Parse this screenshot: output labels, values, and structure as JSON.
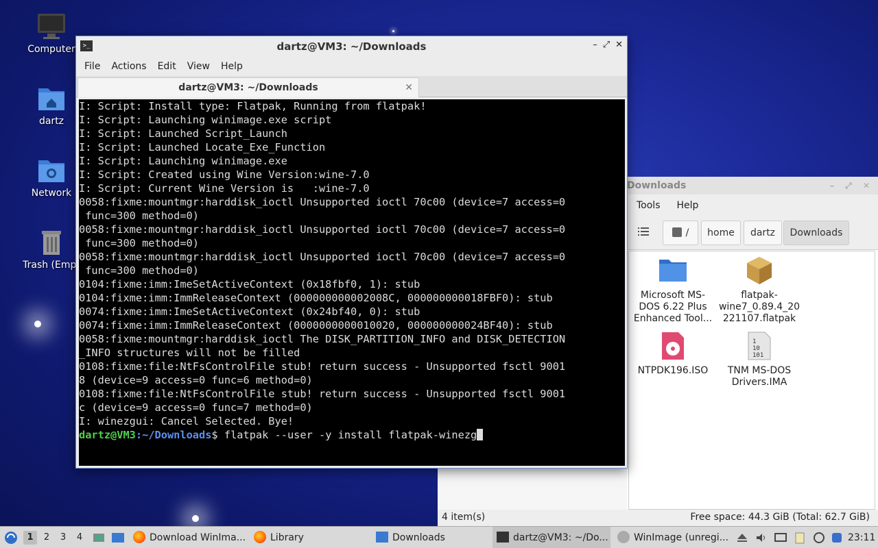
{
  "desktop": {
    "icons": [
      {
        "label": "Computer",
        "icon": "computer-icon"
      },
      {
        "label": "dartz",
        "icon": "home-folder-icon"
      },
      {
        "label": "Network",
        "icon": "network-folder-icon"
      },
      {
        "label": "Trash (Empt",
        "icon": "trash-icon"
      }
    ]
  },
  "terminal": {
    "window_title": "dartz@VM3: ~/Downloads",
    "menu": [
      "File",
      "Actions",
      "Edit",
      "View",
      "Help"
    ],
    "tab_title": "dartz@VM3: ~/Downloads",
    "lines": [
      "I: Script: Install type: Flatpak, Running from flatpak!",
      "I: Script: Launching winimage.exe script",
      "I: Script: Launched Script_Launch",
      "I: Script: Launched Locate_Exe_Function",
      "I: Script: Launching winimage.exe",
      "I: Script: Created using Wine Version:wine-7.0",
      "I: Script: Current Wine Version is   :wine-7.0",
      "0058:fixme:mountmgr:harddisk_ioctl Unsupported ioctl 70c00 (device=7 access=0",
      " func=300 method=0)",
      "0058:fixme:mountmgr:harddisk_ioctl Unsupported ioctl 70c00 (device=7 access=0",
      " func=300 method=0)",
      "0058:fixme:mountmgr:harddisk_ioctl Unsupported ioctl 70c00 (device=7 access=0",
      " func=300 method=0)",
      "0104:fixme:imm:ImeSetActiveContext (0x18fbf0, 1): stub",
      "0104:fixme:imm:ImmReleaseContext (000000000002008C, 000000000018FBF0): stub",
      "0074:fixme:imm:ImeSetActiveContext (0x24bf40, 0): stub",
      "0074:fixme:imm:ImmReleaseContext (0000000000010020, 000000000024BF40): stub",
      "0058:fixme:mountmgr:harddisk_ioctl The DISK_PARTITION_INFO and DISK_DETECTION",
      "_INFO structures will not be filled",
      "0108:fixme:file:NtFsControlFile stub! return success - Unsupported fsctl 9001",
      "8 (device=9 access=0 func=6 method=0)",
      "0108:fixme:file:NtFsControlFile stub! return success - Unsupported fsctl 9001",
      "c (device=9 access=0 func=7 method=0)",
      "I: winezgui: Cancel Selected. Bye!"
    ],
    "prompt_user": "dartz@VM3",
    "prompt_sep": ":",
    "prompt_path": "~/Downloads",
    "prompt_symbol": "$",
    "command": "flatpak --user -y install flatpak-winezg"
  },
  "filemanager": {
    "window_title": "Downloads",
    "menu": [
      "Tools",
      "Help"
    ],
    "crumbs": [
      "/",
      "home",
      "dartz",
      "Downloads"
    ],
    "files": [
      {
        "name": "Microsoft MS-DOS 6.22 Plus Enhanced Tool...",
        "icon": "folder-icon"
      },
      {
        "name": "flatpak-wine7_0.89.4_20221107.flatpak",
        "icon": "package-icon"
      },
      {
        "name": "NTPDK196.ISO",
        "icon": "disc-image-icon"
      },
      {
        "name": "TNM MS-DOS Drivers.IMA",
        "icon": "binary-file-icon"
      }
    ],
    "file_lines": [
      [
        "Microsoft MS-",
        "DOS 6.22 Plus",
        "Enhanced Tool..."
      ],
      [
        "flatpak-",
        "wine7_0.89.4_20",
        "221107.flatpak"
      ],
      [
        "NTPDK196.ISO"
      ],
      [
        "TNM MS-DOS",
        "Drivers.IMA"
      ]
    ],
    "status_items": "4 item(s)",
    "status_free": "Free space: 44.3 GiB (Total: 62.7 GiB)"
  },
  "taskbar": {
    "workspaces": [
      "1",
      "2",
      "3",
      "4"
    ],
    "tasks": [
      {
        "label": "Download WinIma...",
        "icon": "firefox-icon"
      },
      {
        "label": "Library",
        "icon": "firefox-icon"
      },
      {
        "label": "Downloads",
        "icon": "folder-icon"
      },
      {
        "label": "dartz@VM3: ~/Do...",
        "icon": "terminal-icon"
      },
      {
        "label": "WinImage (unregi...",
        "icon": "wine-icon"
      }
    ],
    "clock": "23:11"
  }
}
